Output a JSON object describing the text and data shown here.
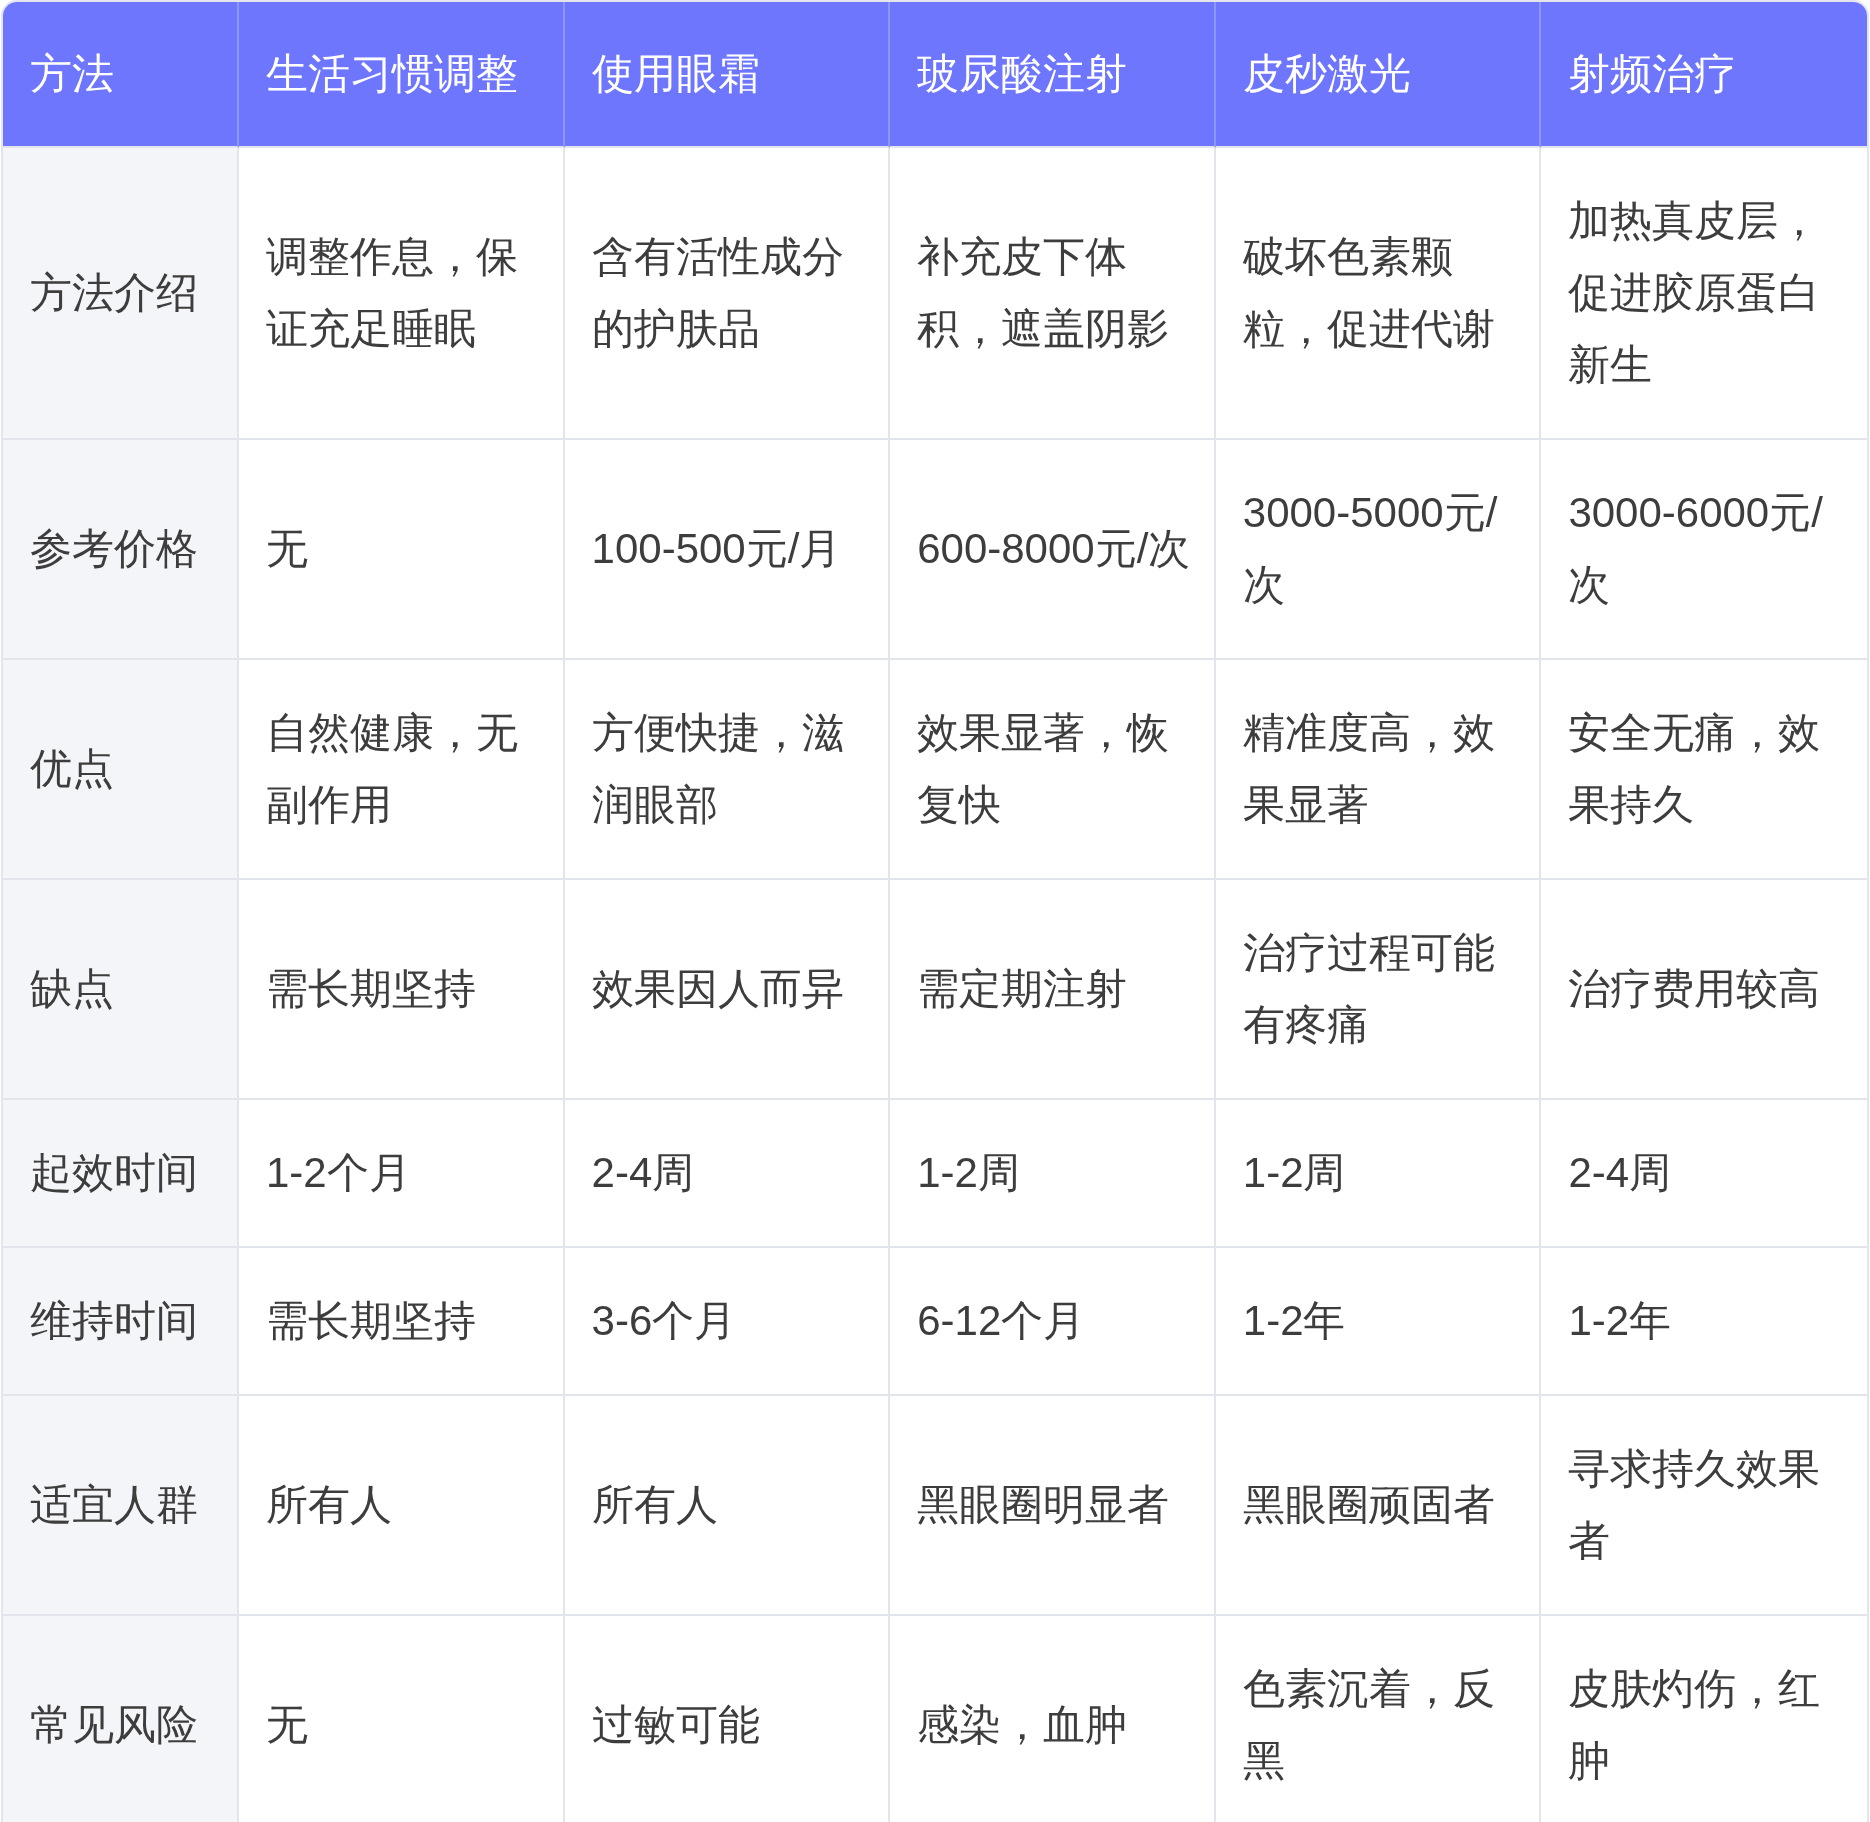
{
  "table": {
    "columns": [
      "方法",
      "生活习惯调整",
      "使用眼霜",
      "玻尿酸注射",
      "皮秒激光",
      "射频治疗"
    ],
    "rows": [
      {
        "cells": [
          "方法介绍",
          "调整作息，保证充足睡眠",
          "含有活性成分的护肤品",
          "补充皮下体积，遮盖阴影",
          "破坏色素颗粒，促进代谢",
          "加热真皮层，促进胶原蛋白新生"
        ]
      },
      {
        "cells": [
          "参考价格",
          "无",
          "100-500元/月",
          "600-8000元/次",
          "3000-5000元/次",
          "3000-6000元/次"
        ]
      },
      {
        "cells": [
          "优点",
          "自然健康，无副作用",
          "方便快捷，滋润眼部",
          "效果显著，恢复快",
          "精准度高，效果显著",
          "安全无痛，效果持久"
        ]
      },
      {
        "cells": [
          "缺点",
          "需长期坚持",
          "效果因人而异",
          "需定期注射",
          "治疗过程可能有疼痛",
          "治疗费用较高"
        ]
      },
      {
        "cells": [
          "起效时间",
          "1-2个月",
          "2-4周",
          "1-2周",
          "1-2周",
          "2-4周"
        ]
      },
      {
        "cells": [
          "维持时间",
          "需长期坚持",
          "3-6个月",
          "6-12个月",
          "1-2年",
          "1-2年"
        ]
      },
      {
        "cells": [
          "适宜人群",
          "所有人",
          "所有人",
          "黑眼圈明显者",
          "黑眼圈顽固者",
          "寻求持久效果者"
        ]
      },
      {
        "cells": [
          "常见风险",
          "无",
          "过敏可能",
          "感染，血肿",
          "色素沉着，反黑",
          "皮肤灼伤，红肿"
        ]
      }
    ]
  }
}
